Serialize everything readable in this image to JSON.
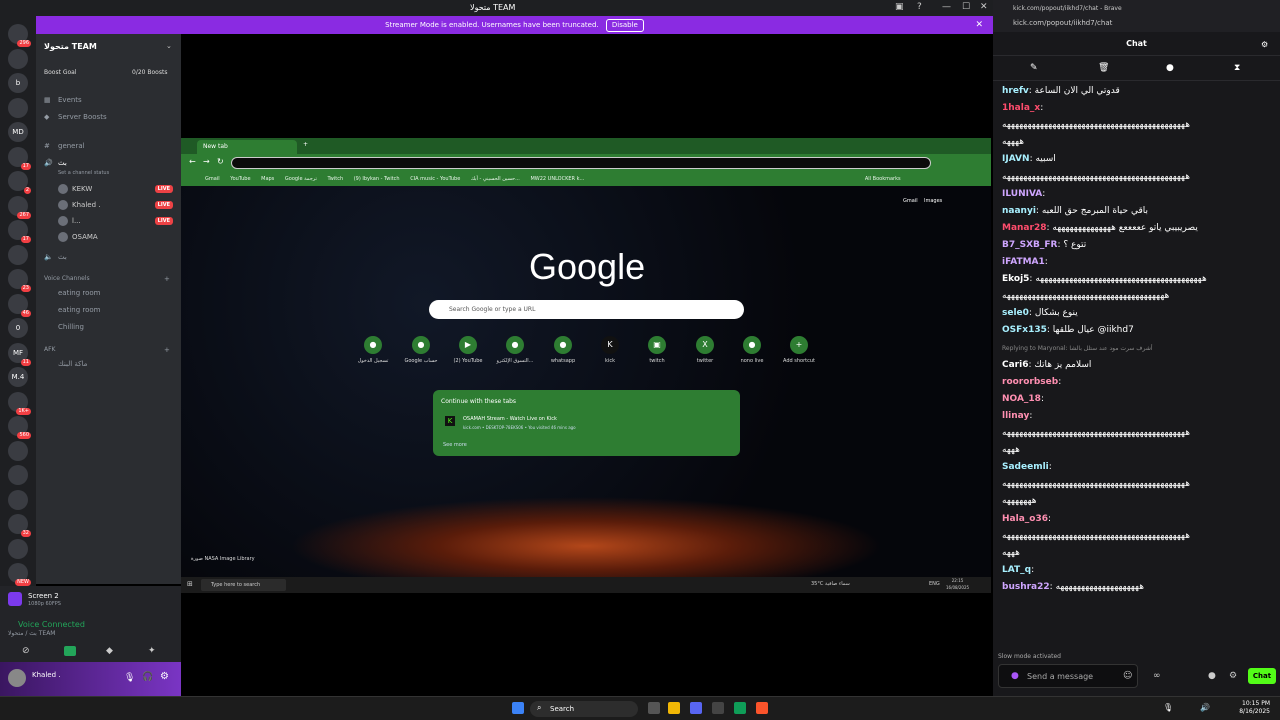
{
  "discord": {
    "window_title": "متحولا TEAM",
    "banner_text": "Streamer Mode is enabled. Usernames have been truncated.",
    "banner_disable": "Disable",
    "server_name": "متحولا TEAM",
    "boost_goal": "Boost Goal",
    "boost_count": "0/20 Boosts",
    "events": "Events",
    "server_boosts": "Server Boosts",
    "channel_general": "general",
    "channel_voice_active": "بث",
    "set_status": "Set a channel status",
    "members": [
      {
        "name": "KEKW",
        "live": "LIVE"
      },
      {
        "name": "Khaled .",
        "live": "LIVE"
      },
      {
        "name": "l...",
        "live": "LIVE"
      },
      {
        "name": "OSAMA",
        "live": ""
      }
    ],
    "channel_voice2": "بث",
    "voice_channels_label": "Voice Channels",
    "voice_channels": [
      "eating room",
      "eating room",
      "Chilling"
    ],
    "afk_label": "AFK",
    "afk_channel": "ماكة البنك",
    "servers": [
      {
        "label": "",
        "badge": "296"
      },
      {
        "label": "",
        "badge": ""
      },
      {
        "label": "b",
        "badge": ""
      },
      {
        "label": "",
        "badge": ""
      },
      {
        "label": "MD",
        "badge": ""
      },
      {
        "label": "",
        "badge": "17"
      },
      {
        "label": "",
        "badge": "2"
      },
      {
        "label": "",
        "badge": "267"
      },
      {
        "label": "",
        "badge": "17"
      },
      {
        "label": "",
        "badge": ""
      },
      {
        "label": "",
        "badge": "23"
      },
      {
        "label": "",
        "badge": "46"
      },
      {
        "label": "0",
        "badge": ""
      },
      {
        "label": "MF",
        "badge": "11"
      },
      {
        "label": "M.4",
        "badge": ""
      },
      {
        "label": "",
        "badge": "1K+"
      },
      {
        "label": "",
        "badge": "560"
      },
      {
        "label": "",
        "badge": ""
      },
      {
        "label": "",
        "badge": ""
      },
      {
        "label": "",
        "badge": ""
      },
      {
        "label": "",
        "badge": "32"
      },
      {
        "label": "",
        "badge": ""
      },
      {
        "label": "",
        "badge": "NEW"
      }
    ],
    "screen_share": "Screen 2",
    "screen_sub": "1080p 60FPS",
    "voice_connected": "Voice Connected",
    "voice_sub": "بث / متحولا TEAM",
    "username": "Khaled ."
  },
  "chrome": {
    "tab_title": "New tab",
    "bookmarks": [
      "Gmail",
      "YouTube",
      "Maps",
      "Google ترجمة",
      "Twitch",
      "(9) Ibykan - Twitch",
      "CIA music - YouTube",
      "حسين الحسيني - أبك...",
      "MW22 UNLOCKER k...",
      "All Bookmarks"
    ],
    "top_links": [
      "Gmail",
      "Images"
    ],
    "logo": "Google",
    "search_placeholder": "Search Google or type a URL",
    "shortcuts": [
      "تسجيل الدخول",
      "Google حساب",
      "(2) YouTube",
      "التسوق الإلكترو...",
      "whatsapp",
      "kick",
      "twitch",
      "twitter",
      "nono live",
      "Add shortcut"
    ],
    "continue_title": "Continue with these tabs",
    "continue_item": "OSAMAH Stream - Watch Live on Kick",
    "continue_sub": "kick.com • DESKTOP-78EKS06 • You visited 46 mins ago",
    "see_more": "See more",
    "credit": "صورة NASA Image Library",
    "taskbar_search": "Type here to search",
    "weather": "35°C سماء صافية",
    "lang": "ENG",
    "time": "22:15",
    "date": "16/08/2025"
  },
  "kick": {
    "window_title": "kick.com/popout/iikhd7/chat - Brave",
    "url": "kick.com/popout/iikhd7/chat",
    "header": "Chat",
    "messages": [
      {
        "user": "hrefv",
        "color": "#a8f0ff",
        "text": "قدوتي الي الان الساعة"
      },
      {
        "user": "1hala_x",
        "color": "#ff4d6d",
        "text": ""
      },
      {
        "user": "",
        "color": "#ffffff",
        "text": "ههههههههههههههههههههههههههههههههههههههههههههه"
      },
      {
        "user": "",
        "color": "#ffffff",
        "text": "ههههه"
      },
      {
        "user": "IJAVN",
        "color": "#a8f0ff",
        "text": "اسبيه"
      },
      {
        "user": "",
        "color": "#ffffff",
        "text": "ههههههههههههههههههههههههههههههههههههههههههههه"
      },
      {
        "user": "ILUNIVA",
        "color": "#cfa6ff",
        "text": ""
      },
      {
        "user": "naanyi",
        "color": "#a8f0ff",
        "text": "باقي حياة المبرمج حق اللعبه"
      },
      {
        "user": "Manar28",
        "color": "#ff4d6d",
        "text": "يصريبيبي ياتو عععععع ههههههههههههههه"
      },
      {
        "user": "B7_SXB_FR",
        "color": "#cfa6ff",
        "text": "تتوع ؟"
      },
      {
        "user": "iFATMA1",
        "color": "#cfa6ff",
        "text": ""
      },
      {
        "user": "Ekoj5",
        "color": "#ffffff",
        "text": "ههههههههههههههههههههههههههههههههههههههههه"
      },
      {
        "user": "",
        "color": "#ffffff",
        "text": "هههههههههههههههههههههههههههههههههههههههه"
      },
      {
        "user": "sele0",
        "color": "#a8f0ff",
        "text": "ينوع بشكال"
      },
      {
        "user": "OSFx135",
        "color": "#a8f0ff",
        "text": "عيال طلقها @iikhd7"
      },
      {
        "user": "",
        "color": "#888888",
        "text": "Replying to Maryonal: أشرف سرت مود عند ستلل بالشا"
      },
      {
        "user": "Cari6",
        "color": "#ffffff",
        "text": "اسلامم يز هاتك"
      },
      {
        "user": "roororbseb",
        "color": "#ff8fb1",
        "text": ""
      },
      {
        "user": "NOA_18",
        "color": "#ff8fb1",
        "text": ""
      },
      {
        "user": "llinay",
        "color": "#ff8fb1",
        "text": ""
      },
      {
        "user": "",
        "color": "#ffffff",
        "text": "ههههههههههههههههههههههههههههههههههههههههههههه"
      },
      {
        "user": "",
        "color": "#ffffff",
        "text": "هههه"
      },
      {
        "user": "Sadeemli",
        "color": "#a8f0ff",
        "text": ""
      },
      {
        "user": "",
        "color": "#ffffff",
        "text": "ههههههههههههههههههههههههههههههههههههههههههههه"
      },
      {
        "user": "",
        "color": "#ffffff",
        "text": "هههههههه"
      },
      {
        "user": "Hala_o36",
        "color": "#ff8fb1",
        "text": ""
      },
      {
        "user": "",
        "color": "#ffffff",
        "text": "ههههههههههههههههههههههههههههههههههههههههههههه"
      },
      {
        "user": "",
        "color": "#ffffff",
        "text": "هههه"
      },
      {
        "user": "LAT_q",
        "color": "#a8f0ff",
        "text": ""
      },
      {
        "user": "bushra22",
        "color": "#cfa6ff",
        "text": "ههههههههههههههههههههه"
      }
    ],
    "slow_mode": "Slow mode activated",
    "input_placeholder": "Send a message",
    "chat_button": "Chat"
  },
  "taskbar": {
    "search": "Search",
    "time": "10:15 PM",
    "date": "8/16/2025"
  }
}
